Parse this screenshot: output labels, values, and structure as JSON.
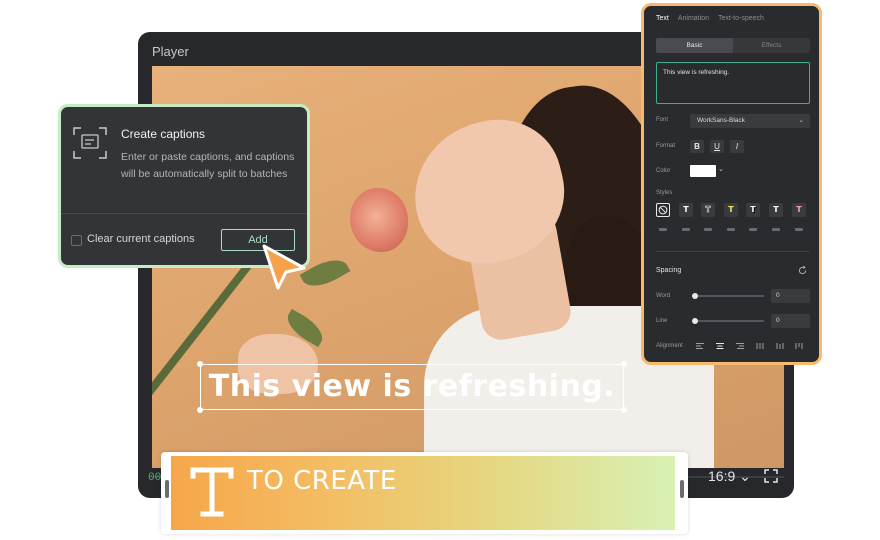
{
  "player": {
    "title": "Player",
    "caption_text": "This view is refreshing.",
    "timecode": "00",
    "aspect_ratio": "16:9 ⌄"
  },
  "captions_popup": {
    "title": "Create captions",
    "description": "Enter or paste captions, and captions will be automatically split to batches",
    "checkbox_label": "Clear current captions",
    "add_button": "Add"
  },
  "panel": {
    "tabs": [
      "Text",
      "Animation",
      "Text-to-speech"
    ],
    "subtabs": [
      "Basic",
      "Effects"
    ],
    "text_value": "This view is refreshing.",
    "font_label": "Font",
    "font_value": "WorkSans-Black",
    "format_label": "Format",
    "format_buttons": [
      "B",
      "U",
      "I"
    ],
    "color_label": "Color",
    "color_value": "#ffffff",
    "styles_label": "Styles",
    "style_glyph": "T",
    "spacing_title": "Spacing",
    "word_label": "Word",
    "word_value": "0",
    "line_label": "Line",
    "line_value": "0",
    "alignment_label": "Alignment"
  },
  "banner": {
    "text": "TO CREATE"
  },
  "colors": {
    "accent_green": "#3fae8a",
    "popup_border": "#c7ecc4",
    "panel_border": "#f6b96d",
    "cursor_orange": "#f5a24b"
  },
  "icons": [
    "captions-icon",
    "cursor-icon",
    "fullscreen-icon",
    "reset-icon",
    "no-style-icon",
    "chevron-down-icon",
    "text-t-icon"
  ]
}
